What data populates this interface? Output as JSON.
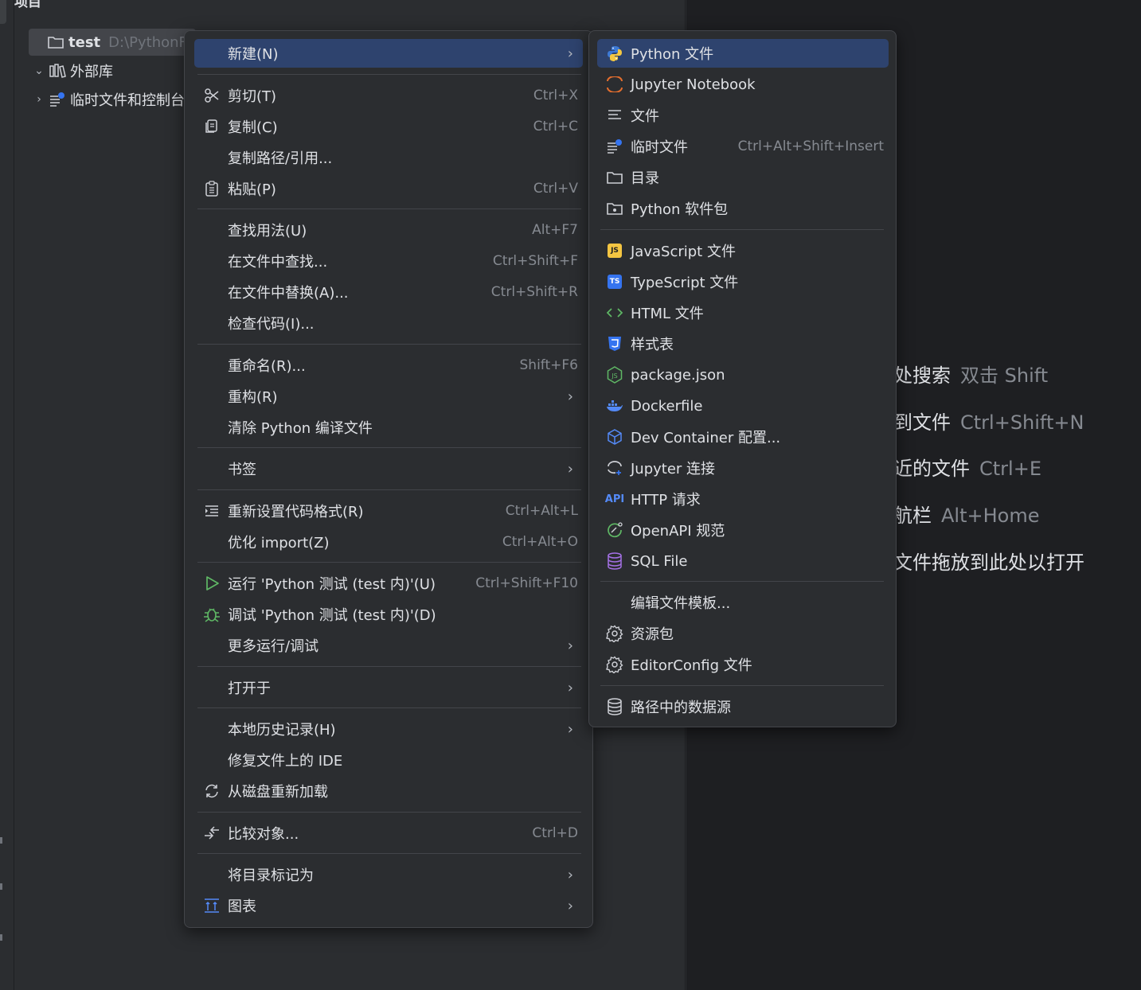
{
  "project_panel": {
    "title": "项目",
    "tree": [
      {
        "label": "test",
        "path": "D:\\PythonF",
        "icon": "folder-icon",
        "expanded": true
      },
      {
        "label": "外部库",
        "icon": "library-icon",
        "expanded": true
      },
      {
        "label": "临时文件和控制台",
        "icon": "scratch-file-icon",
        "expanded": false
      }
    ]
  },
  "editor_hints": [
    {
      "text": "处搜索",
      "keys": "双击 Shift"
    },
    {
      "text": "到文件",
      "keys": "Ctrl+Shift+N"
    },
    {
      "text": "近的文件",
      "keys": "Ctrl+E"
    },
    {
      "text": "航栏",
      "keys": "Alt+Home"
    },
    {
      "text": "文件拖放到此处以打开",
      "keys": ""
    }
  ],
  "context_menu": {
    "items": [
      {
        "label": "新建(N)",
        "shortcut": "",
        "submenu": true,
        "icon": ""
      },
      {
        "label": "剪切(T)",
        "shortcut": "Ctrl+X",
        "icon": "scissors-icon"
      },
      {
        "label": "复制(C)",
        "shortcut": "Ctrl+C",
        "icon": "copy-icon"
      },
      {
        "label": "复制路径/引用...",
        "shortcut": "",
        "icon": ""
      },
      {
        "label": "粘贴(P)",
        "shortcut": "Ctrl+V",
        "icon": "paste-icon"
      },
      {
        "label": "查找用法(U)",
        "shortcut": "Alt+F7",
        "icon": ""
      },
      {
        "label": "在文件中查找...",
        "shortcut": "Ctrl+Shift+F",
        "icon": ""
      },
      {
        "label": "在文件中替换(A)...",
        "shortcut": "Ctrl+Shift+R",
        "icon": ""
      },
      {
        "label": "检查代码(I)...",
        "shortcut": "",
        "icon": ""
      },
      {
        "label": "重命名(R)...",
        "shortcut": "Shift+F6",
        "icon": ""
      },
      {
        "label": "重构(R)",
        "shortcut": "",
        "submenu": true,
        "icon": ""
      },
      {
        "label": "清除 Python 编译文件",
        "shortcut": "",
        "icon": ""
      },
      {
        "label": "书签",
        "shortcut": "",
        "submenu": true,
        "icon": ""
      },
      {
        "label": "重新设置代码格式(R)",
        "shortcut": "Ctrl+Alt+L",
        "icon": "reformat-icon"
      },
      {
        "label": "优化 import(Z)",
        "shortcut": "Ctrl+Alt+O",
        "icon": ""
      },
      {
        "label": "运行 'Python 测试 (test 内)'(U)",
        "shortcut": "Ctrl+Shift+F10",
        "icon": "run-icon"
      },
      {
        "label": "调试 'Python 测试 (test 内)'(D)",
        "shortcut": "",
        "icon": "debug-icon"
      },
      {
        "label": "更多运行/调试",
        "shortcut": "",
        "submenu": true,
        "icon": ""
      },
      {
        "label": "打开于",
        "shortcut": "",
        "submenu": true,
        "icon": ""
      },
      {
        "label": "本地历史记录(H)",
        "shortcut": "",
        "submenu": true,
        "icon": ""
      },
      {
        "label": "修复文件上的 IDE",
        "shortcut": "",
        "icon": ""
      },
      {
        "label": "从磁盘重新加载",
        "shortcut": "",
        "icon": "reload-icon"
      },
      {
        "label": "比较对象...",
        "shortcut": "Ctrl+D",
        "icon": "compare-icon"
      },
      {
        "label": "将目录标记为",
        "shortcut": "",
        "submenu": true,
        "icon": ""
      },
      {
        "label": "图表",
        "shortcut": "",
        "submenu": true,
        "icon": "diagram-icon"
      }
    ]
  },
  "new_submenu": {
    "items": [
      {
        "label": "Python 文件",
        "shortcut": "",
        "icon": "python-icon"
      },
      {
        "label": "Jupyter Notebook",
        "shortcut": "",
        "icon": "jupyter-icon"
      },
      {
        "label": "文件",
        "shortcut": "",
        "icon": "text-file-icon"
      },
      {
        "label": "临时文件",
        "shortcut": "Ctrl+Alt+Shift+Insert",
        "icon": "scratch-file-icon"
      },
      {
        "label": "目录",
        "shortcut": "",
        "icon": "folder-icon"
      },
      {
        "label": "Python 软件包",
        "shortcut": "",
        "icon": "package-icon"
      },
      {
        "label": "JavaScript 文件",
        "shortcut": "",
        "icon": "javascript-icon",
        "badge": "JS"
      },
      {
        "label": "TypeScript 文件",
        "shortcut": "",
        "icon": "typescript-icon",
        "badge": "TS"
      },
      {
        "label": "HTML 文件",
        "shortcut": "",
        "icon": "html-icon"
      },
      {
        "label": "样式表",
        "shortcut": "",
        "icon": "css-icon"
      },
      {
        "label": "package.json",
        "shortcut": "",
        "icon": "nodejs-icon"
      },
      {
        "label": "Dockerfile",
        "shortcut": "",
        "icon": "docker-icon"
      },
      {
        "label": "Dev Container 配置...",
        "shortcut": "",
        "icon": "cube-icon"
      },
      {
        "label": "Jupyter 连接",
        "shortcut": "",
        "icon": "jupyter-connect-icon"
      },
      {
        "label": "HTTP 请求",
        "shortcut": "",
        "icon": "api-icon",
        "badge": "API"
      },
      {
        "label": "OpenAPI 规范",
        "shortcut": "",
        "icon": "openapi-icon"
      },
      {
        "label": "SQL File",
        "shortcut": "",
        "icon": "database-icon"
      },
      {
        "label": "编辑文件模板...",
        "shortcut": "",
        "icon": ""
      },
      {
        "label": "资源包",
        "shortcut": "",
        "icon": "gear-icon"
      },
      {
        "label": "EditorConfig 文件",
        "shortcut": "",
        "icon": "gear-icon"
      },
      {
        "label": "路径中的数据源",
        "shortcut": "",
        "icon": "database-icon"
      }
    ]
  },
  "colors": {
    "background": "#2b2d30",
    "editor": "#1e1f22",
    "selection": "#2e436e",
    "shortcut_text": "#868a91",
    "separator": "#43454a"
  }
}
